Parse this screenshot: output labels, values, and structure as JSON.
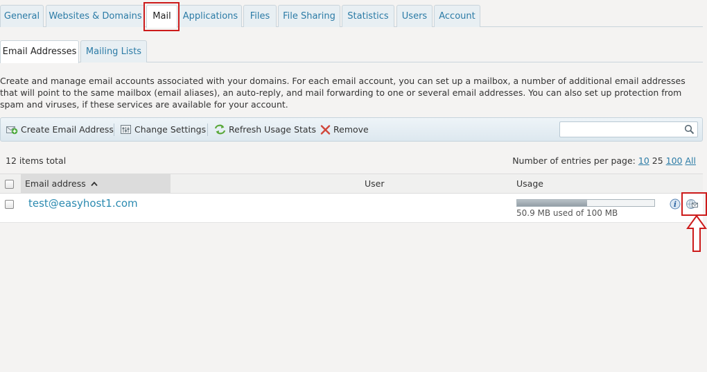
{
  "top_tabs": [
    "General",
    "Websites & Domains",
    "Mail",
    "Applications",
    "Files",
    "File Sharing",
    "Statistics",
    "Users",
    "Account"
  ],
  "sub_tabs": [
    "Email Addresses",
    "Mailing Lists"
  ],
  "description": "Create and manage email accounts associated with your domains. For each email account, you can set up a mailbox, a number of additional email addresses that will point to the same mailbox (email aliases), an auto-reply, and mail forwarding to one or several email addresses. You can also set up protection from spam and viruses, if these services are available for your account.",
  "toolbar": {
    "create": "Create Email Address",
    "settings": "Change Settings",
    "refresh": "Refresh Usage Stats",
    "remove": "Remove",
    "search_value": ""
  },
  "list": {
    "total": "12 items total",
    "per_page_label": "Number of entries per page:",
    "per_page_options": [
      "10",
      "25",
      "100",
      "All"
    ]
  },
  "table": {
    "columns": [
      "Email address",
      "User",
      "Usage"
    ],
    "rows": [
      {
        "email": "test@easyhost1.com",
        "user": "",
        "usage_fraction": 0.509,
        "usage_text": "50.9 MB used of 100 MB"
      }
    ]
  },
  "colors": {
    "link": "#2b8ab0",
    "highlight": "#cc1a1a",
    "toolbar_bg": "#dde8ef"
  }
}
